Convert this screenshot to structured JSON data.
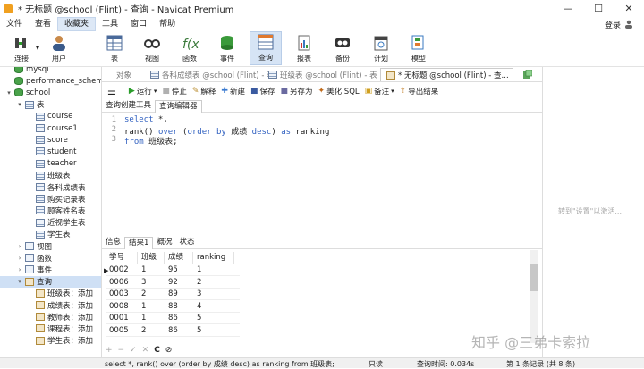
{
  "window": {
    "title": "* 无标题 @school (Flint) - 查询 - Navicat Premium"
  },
  "window_controls": {
    "minimize": "—",
    "maximize": "☐",
    "close": "✕"
  },
  "menu": {
    "items": [
      "文件",
      "查看",
      "收藏夹",
      "工具",
      "窗口",
      "帮助"
    ],
    "active_index": 2,
    "login": "登录"
  },
  "toolbar": [
    {
      "label": "连接",
      "icon": "connection-icon"
    },
    {
      "label": "用户",
      "icon": "user-icon"
    },
    {
      "label": "表",
      "icon": "table-icon"
    },
    {
      "label": "视图",
      "icon": "view-icon"
    },
    {
      "label": "函数",
      "icon": "function-icon"
    },
    {
      "label": "事件",
      "icon": "event-icon"
    },
    {
      "label": "查询",
      "icon": "query-icon",
      "active": true
    },
    {
      "label": "报表",
      "icon": "report-icon"
    },
    {
      "label": "备份",
      "icon": "backup-icon"
    },
    {
      "label": "计划",
      "icon": "schedule-icon"
    },
    {
      "label": "模型",
      "icon": "model-icon"
    }
  ],
  "tree": {
    "nodes": [
      {
        "label": "mysql",
        "indent": 0,
        "twist": "",
        "icon": "db"
      },
      {
        "label": "performance_schema",
        "indent": 0,
        "twist": "",
        "icon": "db"
      },
      {
        "label": "school",
        "indent": 0,
        "twist": "▾",
        "icon": "db"
      },
      {
        "label": "表",
        "indent": 1,
        "twist": "▾",
        "icon": "tbl"
      },
      {
        "label": "course",
        "indent": 2,
        "twist": "",
        "icon": "tbl"
      },
      {
        "label": "course1",
        "indent": 2,
        "twist": "",
        "icon": "tbl"
      },
      {
        "label": "score",
        "indent": 2,
        "twist": "",
        "icon": "tbl"
      },
      {
        "label": "student",
        "indent": 2,
        "twist": "",
        "icon": "tbl"
      },
      {
        "label": "teacher",
        "indent": 2,
        "twist": "",
        "icon": "tbl"
      },
      {
        "label": "班级表",
        "indent": 2,
        "twist": "",
        "icon": "tbl"
      },
      {
        "label": "各科成绩表",
        "indent": 2,
        "twist": "",
        "icon": "tbl"
      },
      {
        "label": "购买记录表",
        "indent": 2,
        "twist": "",
        "icon": "tbl"
      },
      {
        "label": "顾客姓名表",
        "indent": 2,
        "twist": "",
        "icon": "tbl"
      },
      {
        "label": "近视学生表",
        "indent": 2,
        "twist": "",
        "icon": "tbl"
      },
      {
        "label": "学生表",
        "indent": 2,
        "twist": "",
        "icon": "tbl"
      },
      {
        "label": "视图",
        "indent": 1,
        "twist": "›",
        "icon": "view"
      },
      {
        "label": "函数",
        "indent": 1,
        "twist": "›",
        "icon": "fn"
      },
      {
        "label": "事件",
        "indent": 1,
        "twist": "›",
        "icon": "ev"
      },
      {
        "label": "查询",
        "indent": 1,
        "twist": "▾",
        "icon": "q",
        "selected": true
      },
      {
        "label": "班级表：添加",
        "indent": 2,
        "twist": "",
        "icon": "q"
      },
      {
        "label": "成绩表：添加",
        "indent": 2,
        "twist": "",
        "icon": "q"
      },
      {
        "label": "教师表：添加",
        "indent": 2,
        "twist": "",
        "icon": "q"
      },
      {
        "label": "课程表：添加",
        "indent": 2,
        "twist": "",
        "icon": "q"
      },
      {
        "label": "学生表：添加",
        "indent": 2,
        "twist": "",
        "icon": "q"
      }
    ]
  },
  "tabs": [
    {
      "label": "对象"
    },
    {
      "label": "各科成绩表 @school (Flint) - 表"
    },
    {
      "label": "班级表 @school (Flint) - 表"
    },
    {
      "label": "* 无标题 @school (Flint) - 查...",
      "active": true
    }
  ],
  "editor_toolbar": [
    {
      "label": "运行",
      "glyph": "▶",
      "color": "#2a9d2a",
      "dropdown": "▾"
    },
    {
      "label": "停止",
      "glyph": "■",
      "color": "#b0b0b0"
    },
    {
      "label": "解释",
      "glyph": "✎",
      "color": "#b88a2a"
    },
    {
      "label": "新建",
      "glyph": "✚",
      "color": "#3a7ad0"
    },
    {
      "label": "保存",
      "glyph": "■",
      "color": "#3a5aa0"
    },
    {
      "label": "另存为",
      "glyph": "■",
      "color": "#6a6aa0"
    },
    {
      "label": "美化 SQL",
      "glyph": "✦",
      "color": "#c06a1a"
    },
    {
      "label": "备注",
      "glyph": "▣",
      "color": "#d0a020",
      "dropdown": "▾"
    },
    {
      "label": "导出结果",
      "glyph": "⇪",
      "color": "#c07a20"
    }
  ],
  "sub_tabs": [
    {
      "label": "查询创建工具"
    },
    {
      "label": "查询编辑器",
      "active": true
    }
  ],
  "editor": {
    "lines": [
      {
        "num": "1",
        "parts": [
          {
            "t": "select",
            "kw": true
          },
          {
            "t": " *,"
          }
        ]
      },
      {
        "num": "2",
        "parts": [
          {
            "t": "rank() "
          },
          {
            "t": "over",
            "kw": true
          },
          {
            "t": " ("
          },
          {
            "t": "order by",
            "kw": true
          },
          {
            "t": " 成绩 "
          },
          {
            "t": "desc",
            "kw": true
          },
          {
            "t": ") "
          },
          {
            "t": "as",
            "kw": true
          },
          {
            "t": " ranking"
          }
        ]
      },
      {
        "num": "3",
        "parts": [
          {
            "t": "from",
            "kw": true
          },
          {
            "t": " 班级表;"
          }
        ]
      }
    ]
  },
  "result_tabs": [
    {
      "label": "信息"
    },
    {
      "label": "结果1",
      "active": true
    },
    {
      "label": "概况"
    },
    {
      "label": "状态"
    }
  ],
  "grid": {
    "columns": [
      "学号",
      "班级",
      "成绩",
      "ranking"
    ],
    "rows": [
      [
        "0002",
        "1",
        "95",
        "1"
      ],
      [
        "0006",
        "3",
        "92",
        "2"
      ],
      [
        "0003",
        "2",
        "89",
        "3"
      ],
      [
        "0008",
        "1",
        "88",
        "4"
      ],
      [
        "0001",
        "1",
        "86",
        "5"
      ],
      [
        "0005",
        "2",
        "86",
        "5"
      ]
    ],
    "current_row_marker": "▶"
  },
  "grid_nav": [
    "+",
    "−",
    "✓",
    "✕",
    "C",
    "⊘"
  ],
  "activate_text": "转到\"设置\"以激活...",
  "watermark": "知乎 @三弟卡索拉",
  "status": {
    "sql": "select *, rank() over (order by 成绩 desc) as ranking  from 班级表;",
    "mode": "只读",
    "time": "查询时间: 0.034s",
    "records": "第 1 条记录 (共 8 条)"
  }
}
